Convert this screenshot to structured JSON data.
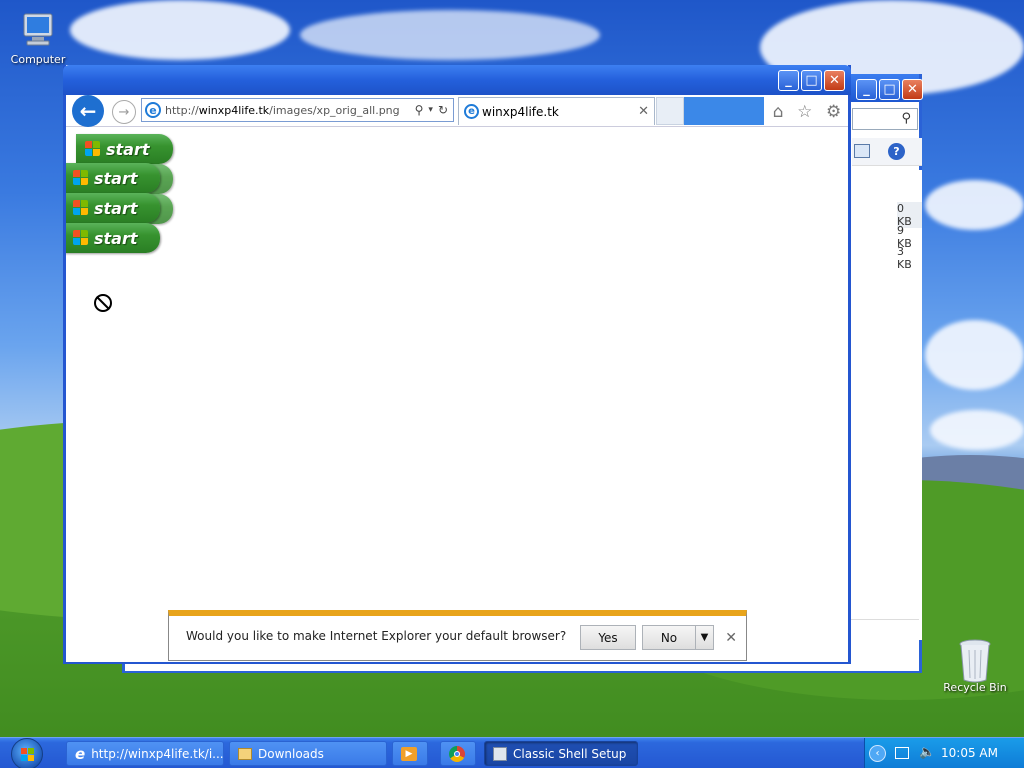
{
  "desktop": {
    "icons": [
      {
        "label": "Computer"
      },
      {
        "label": "Recycle Bin"
      }
    ]
  },
  "downloads_window": {
    "sizes": [
      "0 KB",
      "9 KB",
      "3 KB"
    ]
  },
  "ie_window": {
    "url_prefix": "http://",
    "url_domain": "winxp4life.tk",
    "url_path": "/images/xp_orig_all.png",
    "tab_label": "winxp4life.tk",
    "page": {
      "start_buttons": [
        "start",
        "start",
        "start",
        "start"
      ]
    },
    "notification": {
      "message": "Would you like to make Internet Explorer your default browser?",
      "yes": "Yes",
      "no": "No"
    }
  },
  "taskbar": {
    "items": [
      {
        "label": "http://winxp4life.tk/i...",
        "active": false
      },
      {
        "label": "Downloads",
        "active": false
      },
      {
        "label": "",
        "icon": "media-player-icon"
      },
      {
        "label": "",
        "icon": "chrome-icon"
      },
      {
        "label": "Classic Shell Setup",
        "active": true
      }
    ],
    "clock": "10:05 AM"
  },
  "colors": {
    "xp_blue": "#2456d0",
    "start_green": "#37932f",
    "notif_accent": "#e8a41b",
    "close_red": "#c23b16"
  }
}
